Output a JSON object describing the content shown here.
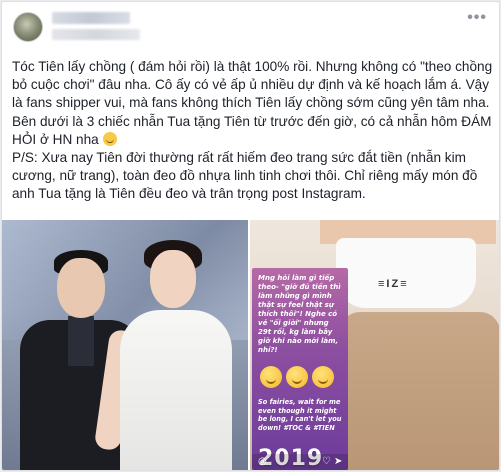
{
  "post": {
    "text": "Tóc Tiên lấy chồng ( đám hỏi rồi) là thật 100% rồi. Nhưng không có \"theo chồng bỏ cuộc chơi\" đâu nha. Cô ấy có vẻ ấp ủ nhiều dự định và kế hoạch lắm á. Vậy là fans shipper vui, mà fans không thích Tiên lấy chồng sớm cũng yên tâm nha. Bên dưới là 3 chiếc nhẫn Tua tặng Tiên từ trước đến giờ, có cả nhẫn hôm ĐÁM HỎI ở HN nha",
    "ps": "P/S: Xưa nay Tiên đời thường rất rất hiếm đeo trang sức đắt tiền (nhẫn kim cương, nữ trang), toàn đeo đồ nhựa linh tinh chơi thôi. Chỉ riêng mấy món đồ anh Tua tặng là Tiên đều đeo và trân trọng post Instagram.",
    "smile_icon": "slightly-smiling-face"
  },
  "menu_icon": "more-horizontal-icon",
  "story": {
    "text_top": "Mng hỏi làm gì tiếp theo- \"giờ đủ tiền thì làm những gì mình thật sự feel thật sự thích thôi\"! Nghe có vẻ \"ối giời\" nhưng 29t rồi, kg làm bây giờ khi nào mới làm, nhỉ?!",
    "text_bottom": "So fairies, wait for me even though it might be long, I can't let you down! #TOC & #TIEN",
    "year": "2019",
    "top_logo": "≡IZ≡"
  }
}
